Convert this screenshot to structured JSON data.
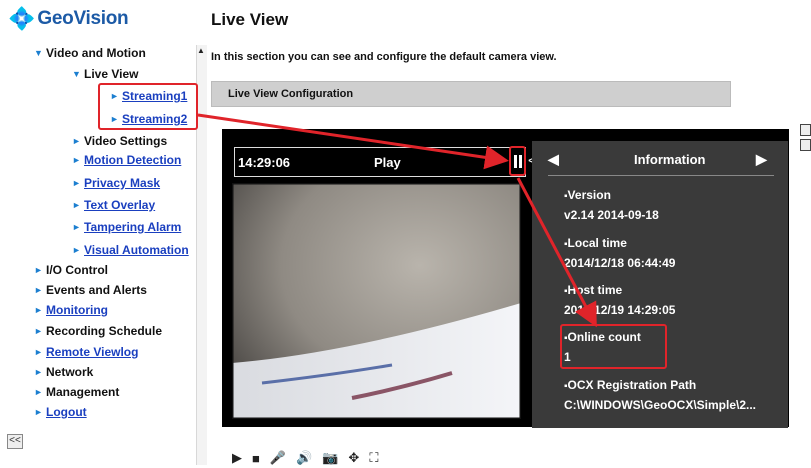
{
  "brand": {
    "name": "GeoVision"
  },
  "sidebar": {
    "items": [
      {
        "label": "Video and Motion",
        "expanded": true
      },
      {
        "label": "Live View",
        "expanded": true
      },
      {
        "label": "Streaming1",
        "link": true
      },
      {
        "label": "Streaming2",
        "link": true
      },
      {
        "label": "Video Settings"
      },
      {
        "label": "Motion Detection",
        "link": true
      },
      {
        "label": "Privacy Mask",
        "link": true
      },
      {
        "label": "Text Overlay",
        "link": true
      },
      {
        "label": "Tampering Alarm",
        "link": true
      },
      {
        "label": "Visual Automation",
        "link": true
      },
      {
        "label": "I/O Control"
      },
      {
        "label": "Events and Alerts"
      },
      {
        "label": "Monitoring",
        "link": true
      },
      {
        "label": "Recording Schedule"
      },
      {
        "label": "Remote Viewlog",
        "link": true
      },
      {
        "label": "Network"
      },
      {
        "label": "Management"
      },
      {
        "label": "Logout",
        "link": true
      }
    ],
    "collapse_label": "<<"
  },
  "main": {
    "title": "Live View",
    "intro": "In this section you can see and configure the default camera view.",
    "section_title": "Live View Configuration"
  },
  "viewer": {
    "time": "14:29:06",
    "status": "Play",
    "info_title": "Information",
    "info": [
      {
        "label": "Version",
        "value": "v2.14  2014-09-18"
      },
      {
        "label": "Local time",
        "value": "2014/12/18 06:44:49"
      },
      {
        "label": "Host time",
        "value": "2014/12/19 14:29:05"
      },
      {
        "label": "Online count",
        "value": "1"
      },
      {
        "label": "OCX Registration Path",
        "value": "C:\\WINDOWS\\GeoOCX\\Simple\\2..."
      }
    ]
  },
  "colors": {
    "brand": "#1c5aa6",
    "link": "#1a3fbf",
    "highlight": "#e0242a",
    "viewer_bg": "#000000",
    "info_bg": "#3a3a3a"
  },
  "icons": [
    "play-icon",
    "stop-icon",
    "microphone-icon",
    "speaker-icon",
    "snapshot-icon",
    "ptz-icon",
    "fullscreen-icon"
  ]
}
